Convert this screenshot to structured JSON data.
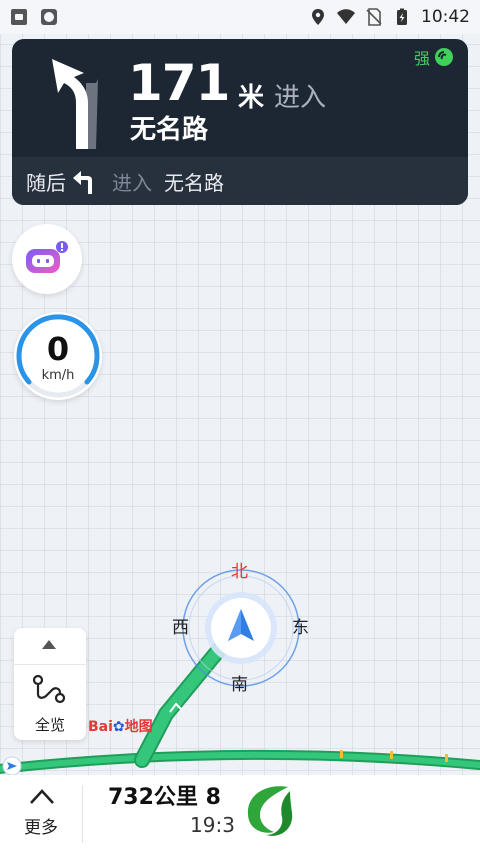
{
  "status_bar": {
    "time": "10:42"
  },
  "guidance": {
    "distance_value": "171",
    "distance_unit": "米",
    "enter_label": "进入",
    "road_name": "无名路",
    "signal_label": "强",
    "next_label": "随后",
    "next_enter_label": "进入",
    "next_road_name": "无名路"
  },
  "speedometer": {
    "speed": "0",
    "unit": "km/h"
  },
  "compass": {
    "north": "北",
    "west": "西",
    "east": "东",
    "south": "南"
  },
  "side_panel": {
    "overview_label": "全览"
  },
  "map": {
    "logo_text": "Bai",
    "logo_text_2": "地图",
    "route_color": "#2fbf71",
    "accent_color": "#2a7de1"
  },
  "bottom_bar": {
    "more_label": "更多",
    "remaining": "732公里 8",
    "eta": "19:3"
  }
}
